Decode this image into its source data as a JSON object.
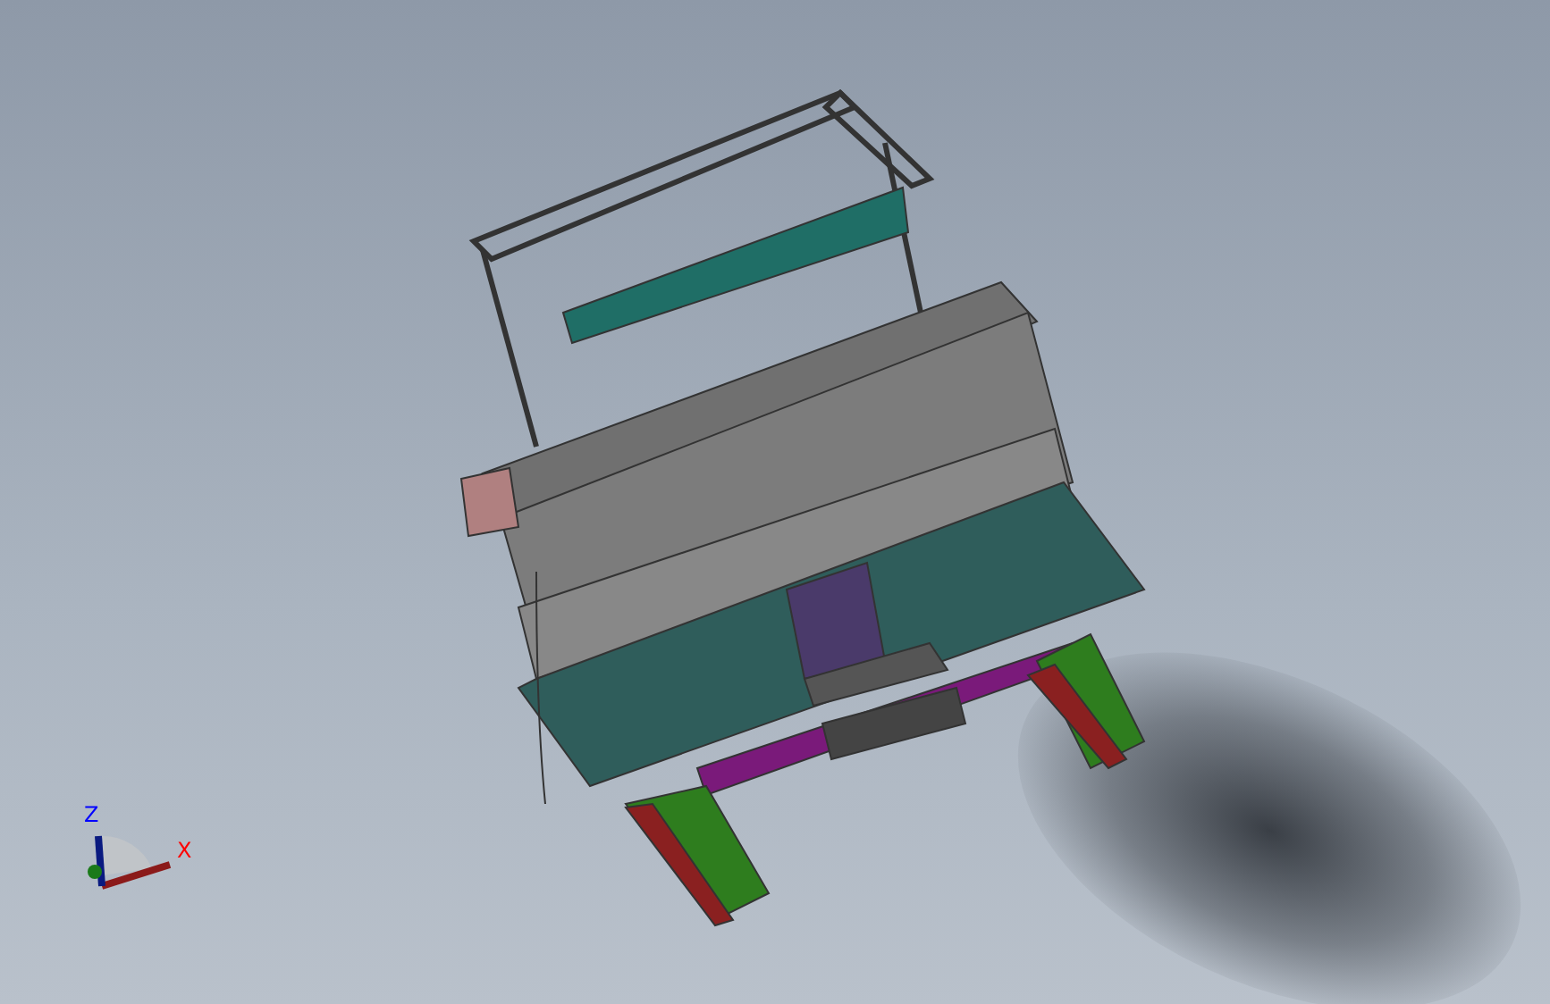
{
  "triad": {
    "axes": [
      {
        "label": "Z",
        "color": "#0000ff"
      },
      {
        "label": "X",
        "color": "#ff0000"
      }
    ]
  }
}
